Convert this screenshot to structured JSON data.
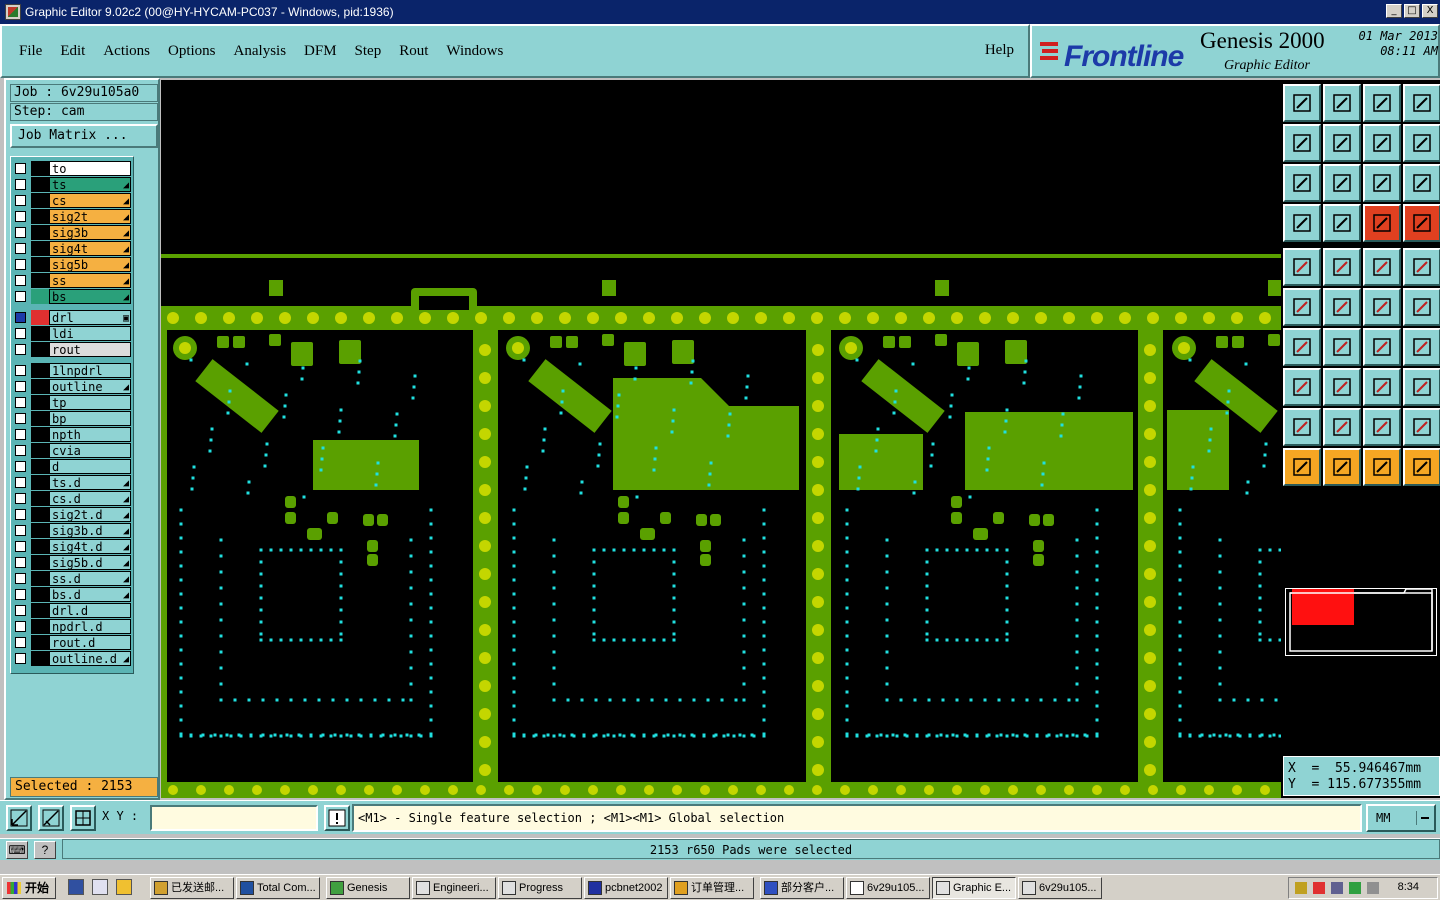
{
  "window": {
    "title": "Graphic Editor 9.02c2 (00@HY-HYCAM-PC037 - Windows, pid:1936)",
    "controls": [
      "_",
      "□",
      "X"
    ]
  },
  "menu": {
    "items": [
      "File",
      "Edit",
      "Actions",
      "Options",
      "Analysis",
      "DFM",
      "Step",
      "Rout",
      "Windows"
    ],
    "help": "Help"
  },
  "brand": {
    "logo": "Frontline",
    "product": "Genesis 2000",
    "subtitle": "Graphic Editor",
    "date": "01 Mar 2013",
    "time": "08:11 AM"
  },
  "left": {
    "job": "Job : 6v29u105a0",
    "step": "Step: cam",
    "job_matrix": "Job Matrix ...",
    "selected": "Selected : 2153",
    "layers": [
      {
        "name": "to",
        "color": "#ffffff",
        "ind": "#000000",
        "arrow": ""
      },
      {
        "name": "ts",
        "color": "#2aa07a",
        "ind": "#000000",
        "arrow": "◢"
      },
      {
        "name": "cs",
        "color": "#f5b041",
        "ind": "#000000",
        "arrow": "◢"
      },
      {
        "name": "sig2t",
        "color": "#f5b041",
        "ind": "#000000",
        "arrow": "◢"
      },
      {
        "name": "sig3b",
        "color": "#f5b041",
        "ind": "#000000",
        "arrow": "◢"
      },
      {
        "name": "sig4t",
        "color": "#f5b041",
        "ind": "#000000",
        "arrow": "◢"
      },
      {
        "name": "sig5b",
        "color": "#f5b041",
        "ind": "#000000",
        "arrow": "◢"
      },
      {
        "name": "ss",
        "color": "#f5b041",
        "ind": "#000000",
        "arrow": "◢"
      },
      {
        "name": "bs",
        "color": "#2aa07a",
        "ind": "#2aa07a",
        "arrow": "◢"
      },
      {
        "name": "drl",
        "color": "#8fd3d3",
        "ind": "#e03030",
        "arrow": "▣"
      },
      {
        "name": "ldi",
        "color": "#8fd3d3",
        "ind": "#000000",
        "arrow": ""
      },
      {
        "name": "rout",
        "color": "#dcdcdc",
        "ind": "#000000",
        "arrow": ""
      },
      {
        "name": "1lnpdrl",
        "color": "#8fd3d3",
        "ind": "#000000",
        "arrow": ""
      },
      {
        "name": "outline",
        "color": "#8fd3d3",
        "ind": "#000000",
        "arrow": "◢"
      },
      {
        "name": "tp",
        "color": "#8fd3d3",
        "ind": "#000000",
        "arrow": ""
      },
      {
        "name": "bp",
        "color": "#8fd3d3",
        "ind": "#000000",
        "arrow": ""
      },
      {
        "name": "npth",
        "color": "#8fd3d3",
        "ind": "#000000",
        "arrow": ""
      },
      {
        "name": "cvia",
        "color": "#8fd3d3",
        "ind": "#000000",
        "arrow": ""
      },
      {
        "name": "d",
        "color": "#8fd3d3",
        "ind": "#000000",
        "arrow": ""
      },
      {
        "name": "ts.d",
        "color": "#8fd3d3",
        "ind": "#000000",
        "arrow": "◢"
      },
      {
        "name": "cs.d",
        "color": "#8fd3d3",
        "ind": "#000000",
        "arrow": "◢"
      },
      {
        "name": "sig2t.d",
        "color": "#8fd3d3",
        "ind": "#000000",
        "arrow": "◢"
      },
      {
        "name": "sig3b.d",
        "color": "#8fd3d3",
        "ind": "#000000",
        "arrow": "◢"
      },
      {
        "name": "sig4t.d",
        "color": "#8fd3d3",
        "ind": "#000000",
        "arrow": "◢"
      },
      {
        "name": "sig5b.d",
        "color": "#8fd3d3",
        "ind": "#000000",
        "arrow": "◢"
      },
      {
        "name": "ss.d",
        "color": "#8fd3d3",
        "ind": "#000000",
        "arrow": "◢"
      },
      {
        "name": "bs.d",
        "color": "#8fd3d3",
        "ind": "#000000",
        "arrow": "◢"
      },
      {
        "name": "drl.d",
        "color": "#8fd3d3",
        "ind": "#000000",
        "arrow": ""
      },
      {
        "name": "npdrl.d",
        "color": "#8fd3d3",
        "ind": "#000000",
        "arrow": ""
      },
      {
        "name": "rout.d",
        "color": "#8fd3d3",
        "ind": "#000000",
        "arrow": ""
      },
      {
        "name": "outline.d",
        "color": "#8fd3d3",
        "ind": "#000000",
        "arrow": "◢"
      }
    ]
  },
  "right": {
    "coord_x": "X  =  55.946467mm",
    "coord_y": "Y  = 115.677355mm"
  },
  "bottom": {
    "xy_label": "X Y :",
    "xy_value": "",
    "prompt": "<M1> - Single feature selection ; <M1><M1> Global selection",
    "units": "MM",
    "status": "2153 r650 Pads were selected"
  },
  "taskbar": {
    "start": "开始",
    "tasks": [
      "已发送邮...",
      "Total Com...",
      "Genesis",
      "Engineeri...",
      "Progress",
      "pcbnet2002",
      "订单管理...",
      "部分客户...",
      "6v29u105...",
      "Graphic E...",
      "6v29u105..."
    ],
    "clock": "8:34"
  },
  "colors": {
    "board": "#5aa000",
    "pad": "#c4d600",
    "drill": "#20e0e0",
    "panel": "#8fd3d3",
    "highlight": "#f5b041"
  }
}
